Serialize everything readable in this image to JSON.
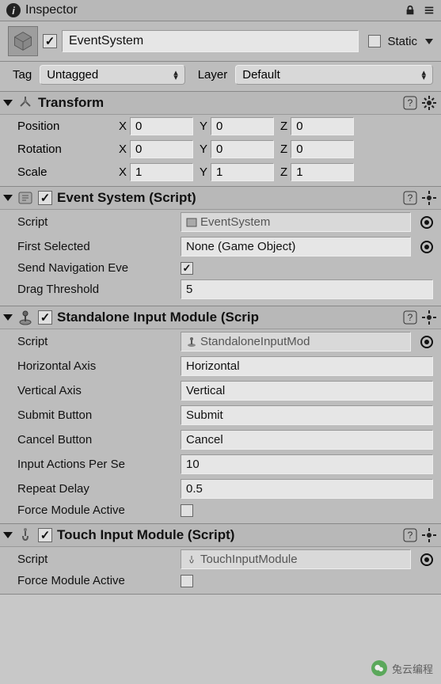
{
  "window": {
    "title": "Inspector"
  },
  "gameObject": {
    "activeChecked": "✓",
    "name": "EventSystem",
    "staticLabel": "Static",
    "staticChecked": ""
  },
  "tagRow": {
    "tagLabel": "Tag",
    "tagValue": "Untagged",
    "layerLabel": "Layer",
    "layerValue": "Default"
  },
  "transform": {
    "title": "Transform",
    "position": {
      "label": "Position",
      "x": "0",
      "y": "0",
      "z": "0"
    },
    "rotation": {
      "label": "Rotation",
      "x": "0",
      "y": "0",
      "z": "0"
    },
    "scale": {
      "label": "Scale",
      "x": "1",
      "y": "1",
      "z": "1"
    }
  },
  "eventSystem": {
    "title": "Event System (Script)",
    "enabledChecked": "✓",
    "scriptLabel": "Script",
    "scriptValue": "EventSystem",
    "firstSelectedLabel": "First Selected",
    "firstSelectedValue": "None (Game Object)",
    "sendNavLabel": "Send Navigation Eve",
    "sendNavChecked": "✓",
    "dragThresholdLabel": "Drag Threshold",
    "dragThresholdValue": "5"
  },
  "standaloneInput": {
    "title": "Standalone Input Module (Scrip",
    "enabledChecked": "✓",
    "scriptLabel": "Script",
    "scriptValue": "StandaloneInputMod",
    "horizAxisLabel": "Horizontal Axis",
    "horizAxisValue": "Horizontal",
    "vertAxisLabel": "Vertical Axis",
    "vertAxisValue": "Vertical",
    "submitLabel": "Submit Button",
    "submitValue": "Submit",
    "cancelLabel": "Cancel Button",
    "cancelValue": "Cancel",
    "inputActionsLabel": "Input Actions Per Se",
    "inputActionsValue": "10",
    "repeatDelayLabel": "Repeat Delay",
    "repeatDelayValue": "0.5",
    "forceActiveLabel": "Force Module Active",
    "forceActiveChecked": ""
  },
  "touchInput": {
    "title": "Touch Input Module (Script)",
    "enabledChecked": "✓",
    "scriptLabel": "Script",
    "scriptValue": "TouchInputModule",
    "forceActiveLabel": "Force Module Active",
    "forceActiveChecked": ""
  },
  "watermark": "兔云编程"
}
